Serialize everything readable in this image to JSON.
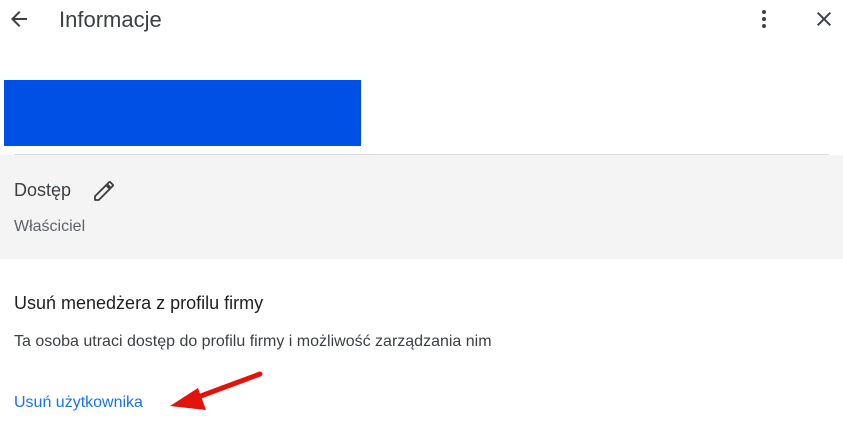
{
  "header": {
    "title": "Informacje",
    "back_icon": "arrow-back-icon",
    "more_icon": "more-vert-icon",
    "close_icon": "close-icon"
  },
  "banner": {
    "color": "#0050e6"
  },
  "access": {
    "label": "Dostęp",
    "value": "Właściciel",
    "edit_icon": "pencil-icon",
    "background": "#f4f4f4"
  },
  "remove_manager": {
    "heading": "Usuń menedżera z profilu firmy",
    "description": "Ta osoba utraci dostęp do profilu firmy i możliwość zarządzania nim",
    "link_label": "Usuń użytkownika",
    "link_color": "#1a73e8"
  },
  "annotation": {
    "arrow_color": "#e3120b"
  }
}
